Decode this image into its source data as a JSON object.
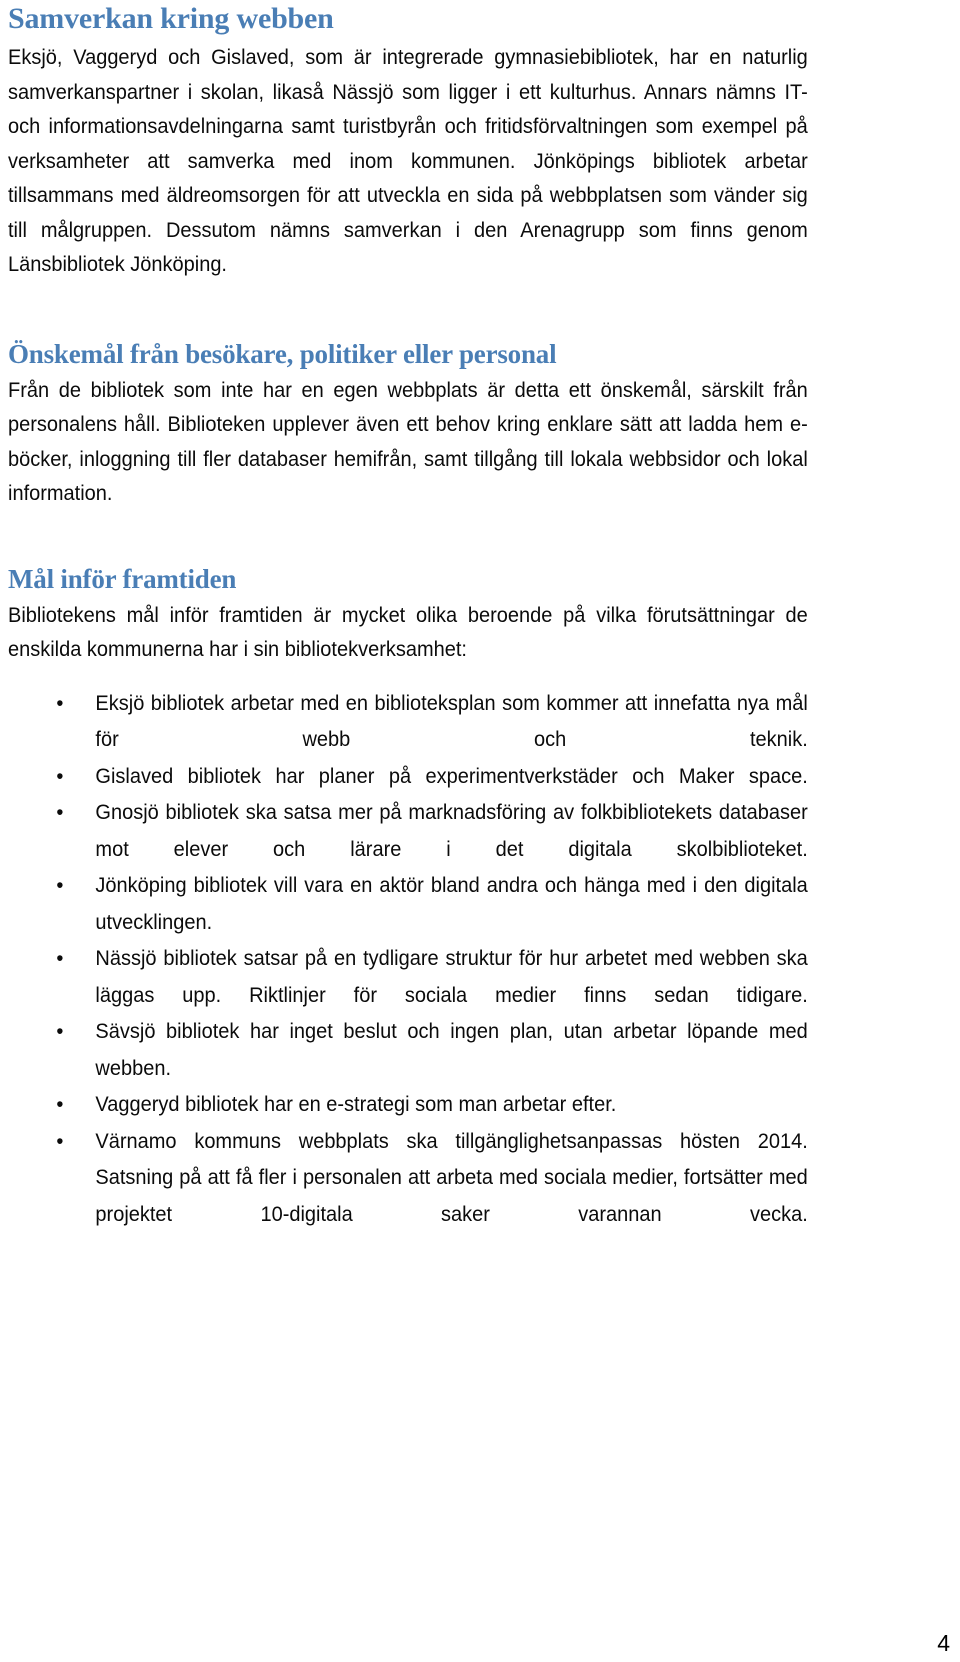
{
  "document": {
    "page_number": "4",
    "heading_color": "#4A7EB5",
    "body_color": "#0B0B0B",
    "background_color": "#FFFFFF"
  },
  "sections": [
    {
      "heading": "Samverkan kring webben",
      "paragraphs": [
        "Eksjö, Vaggeryd och Gislaved, som är integrerade gymnasiebibliotek, har en naturlig samverkanspartner i skolan, likaså Nässjö som ligger i ett kulturhus. Annars nämns IT- och informationsavdelningarna samt turistbyrån och fritidsförvaltningen som exempel på verksamheter att samverka med inom kommunen.  Jönköpings bibliotek arbetar tillsammans med äldreomsorgen för att utveckla en sida på webbplatsen som vänder sig till målgruppen. Dessutom nämns samverkan i den Arenagrupp som finns genom Länsbibliotek Jönköping."
      ]
    },
    {
      "heading": "Önskemål från besökare, politiker eller personal",
      "paragraphs": [
        "Från de bibliotek som inte har en egen webbplats är detta ett önskemål, särskilt från personalens håll. Biblioteken upplever även ett behov kring enklare sätt att ladda hem e-böcker, inloggning till fler databaser hemifrån, samt tillgång till lokala webbsidor och lokal information."
      ]
    },
    {
      "heading": "Mål inför framtiden",
      "paragraphs": [
        "Bibliotekens mål inför framtiden är mycket olika beroende på vilka förutsättningar de enskilda kommunerna har i sin bibliotekverksamhet:"
      ],
      "bullets": [
        "Eksjö bibliotek arbetar med en biblioteksplan som kommer att innefatta nya mål för webb och teknik.",
        "Gislaved bibliotek har planer på experimentverkstäder och Maker space.",
        "Gnosjö bibliotek ska satsa mer på marknadsföring av folkbibliotekets databaser mot elever och lärare i det digitala skolbiblioteket.",
        "Jönköping bibliotek vill vara en aktör bland andra och hänga med i den digitala utvecklingen.",
        "Nässjö bibliotek satsar på en tydligare struktur för hur arbetet med webben ska läggas upp. Riktlinjer för sociala medier finns sedan tidigare.",
        "Sävsjö bibliotek har inget beslut och ingen plan, utan arbetar löpande med webben.",
        "Vaggeryd bibliotek har en e-strategi som man arbetar efter.",
        "Värnamo kommuns webbplats ska tillgänglighetsanpassas hösten 2014. Satsning på att få fler i personalen att arbeta med sociala medier, fortsätter med projektet 10-digitala saker varannan vecka."
      ]
    }
  ],
  "bullet_glyph": "•"
}
